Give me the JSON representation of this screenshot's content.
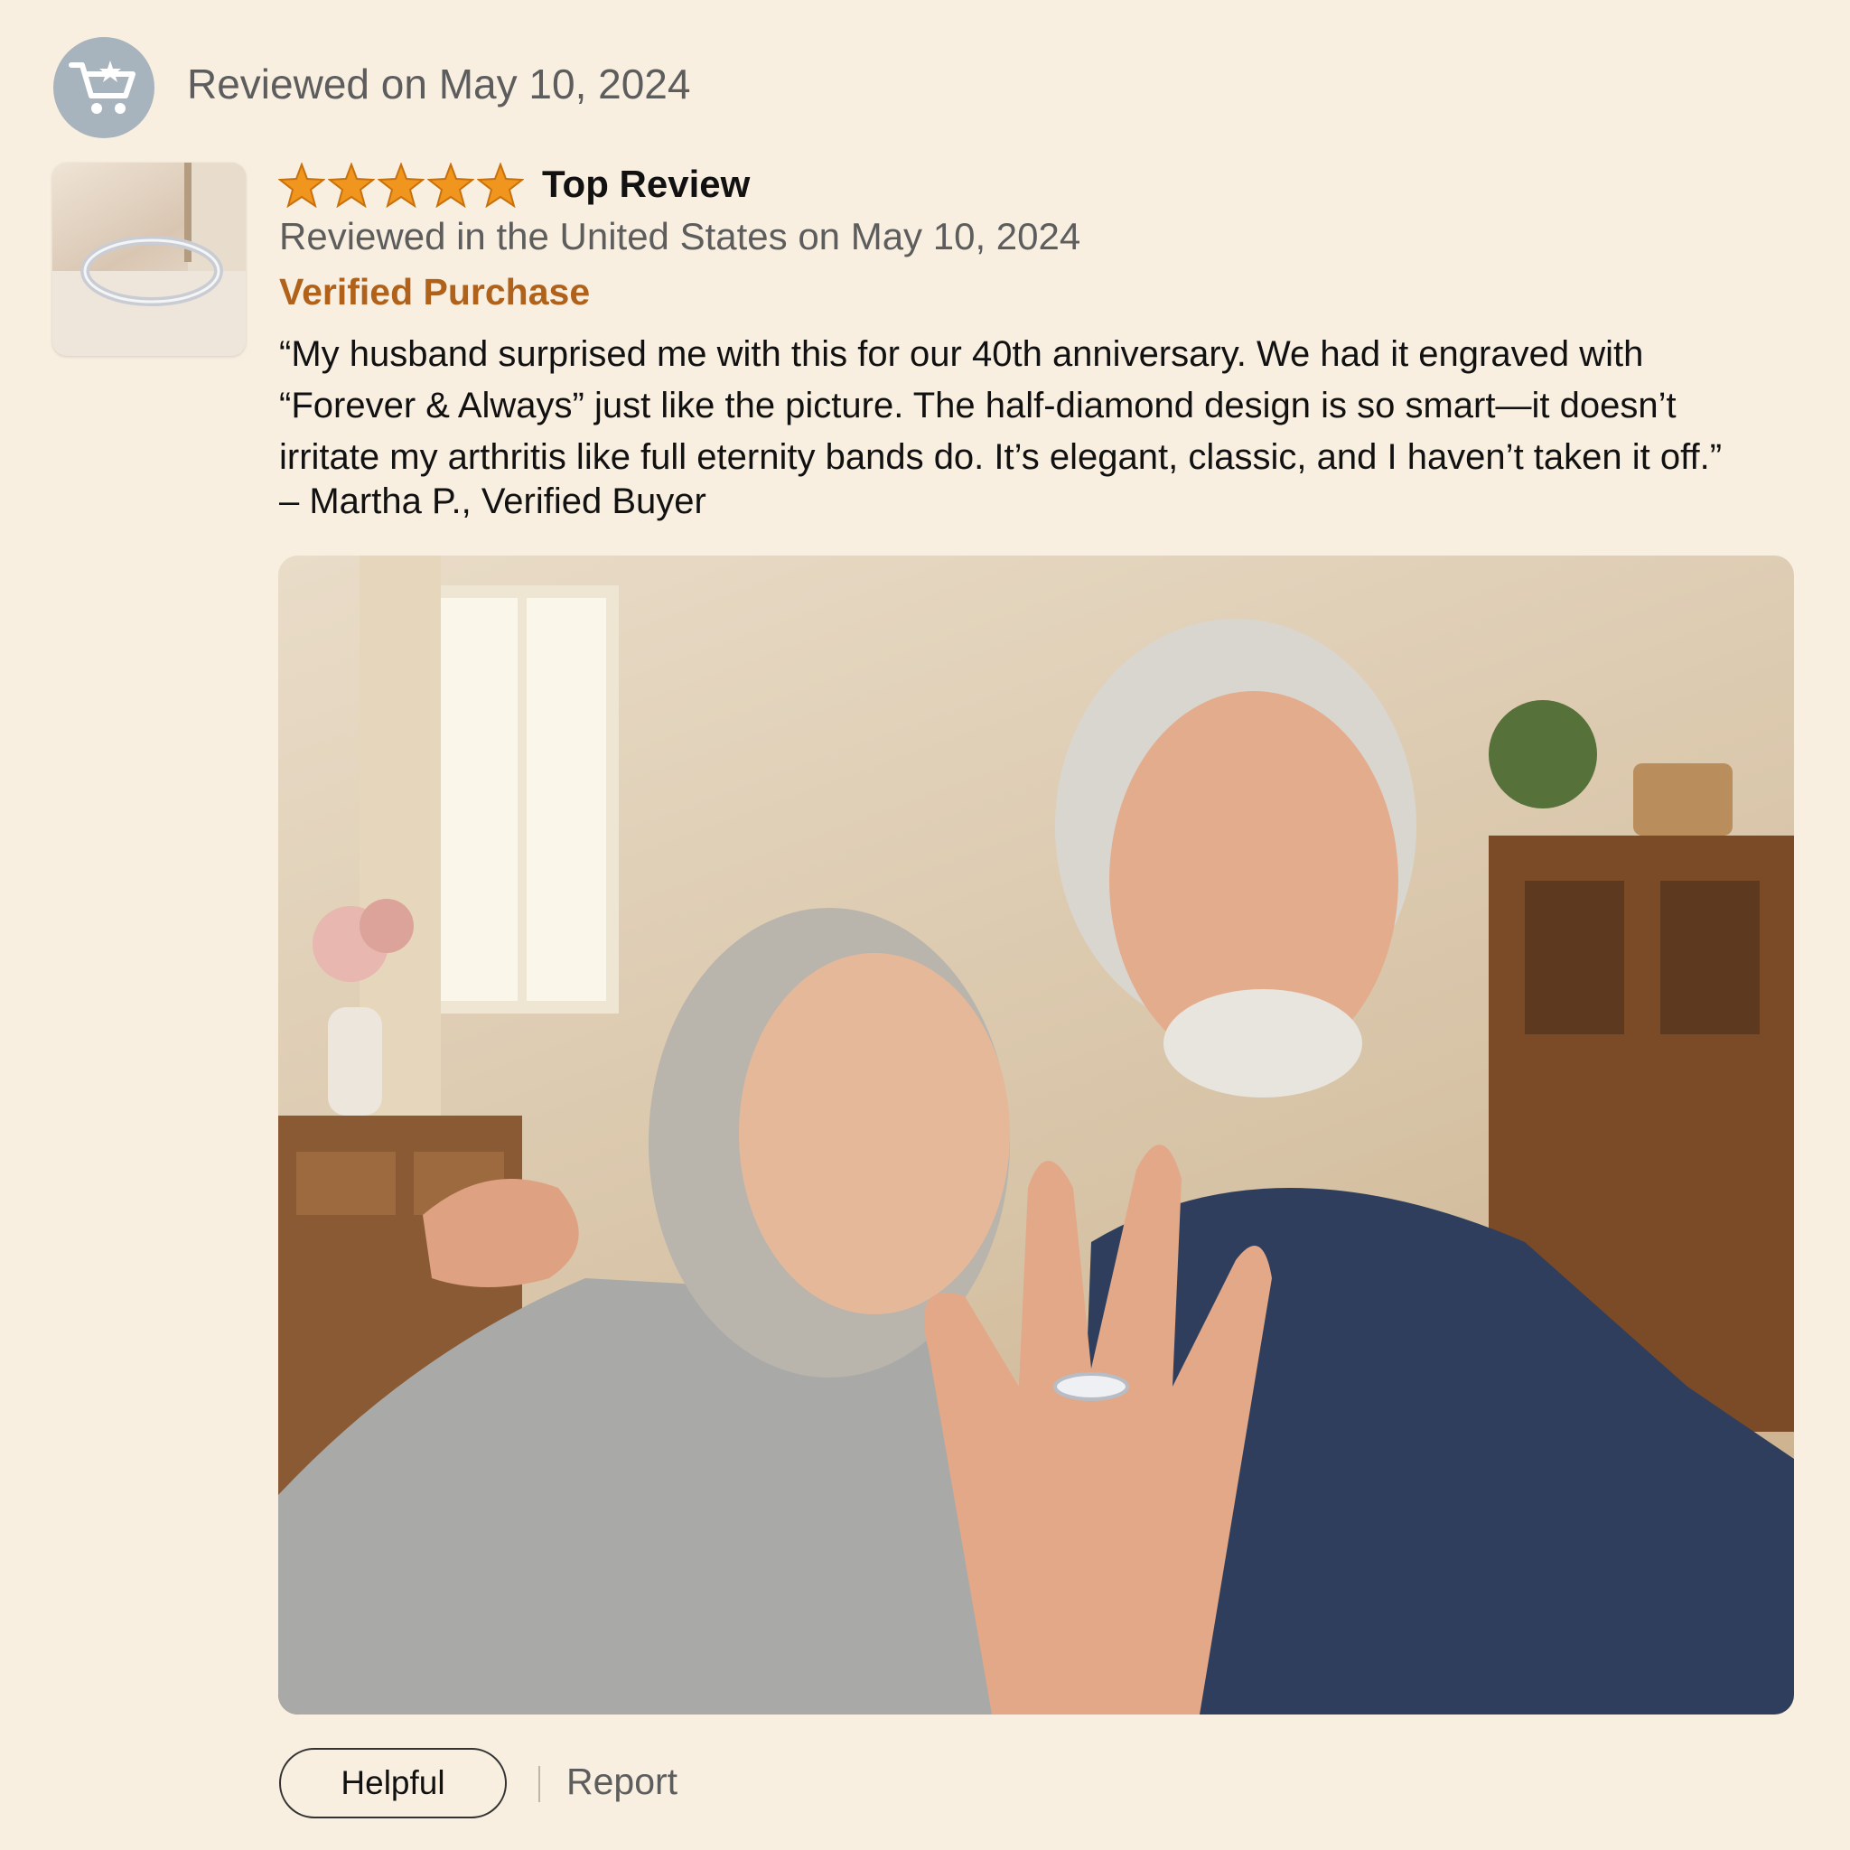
{
  "header": {
    "reviewed_date": "Reviewed on May 10, 2024",
    "avatar_icon": "cart-star-icon"
  },
  "review": {
    "thumbnail": "ring-product-thumbnail",
    "rating": 5,
    "rating_max": 5,
    "star_color": "#f0961e",
    "badge": "Top Review",
    "location_date": "Reviewed in the United States on May 10, 2024",
    "verified": "Verified Purchase",
    "verified_color": "#b0621a",
    "quote": "“My husband surprised me with this for our 40th anniversary. We had it engraved with\n“Forever & Always” just like the picture. The half-diamond design is so smart—it doesn’t\nirritate my arthritis like full eternity bands do. It’s elegant, classic, and I haven’t taken it off.”",
    "author": "– Martha P., Verified Buyer",
    "photo": "customer-photo-couple-showing-ring"
  },
  "actions": {
    "helpful": "Helpful",
    "report": "Report"
  }
}
